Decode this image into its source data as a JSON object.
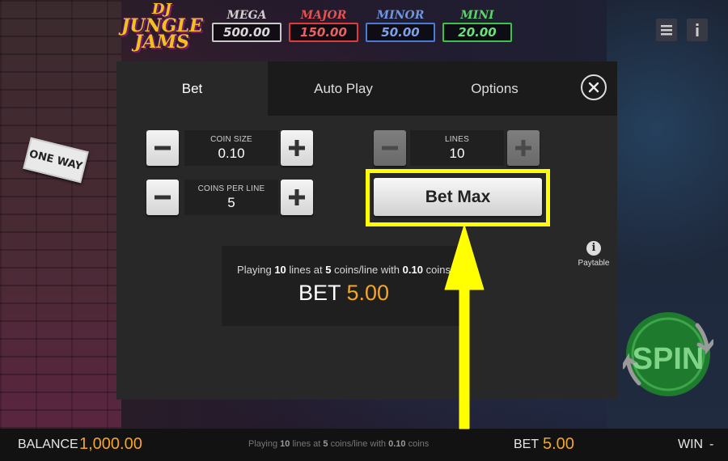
{
  "game": {
    "logo_lines": [
      "DJ",
      "JUNGLE",
      "JAMS"
    ],
    "street_sign": "ONE WAY"
  },
  "jackpots": [
    {
      "name": "MEGA",
      "value": "500.00",
      "color": "#c9c9c9"
    },
    {
      "name": "MAJOR",
      "value": "150.00",
      "color": "#e03a3a"
    },
    {
      "name": "MINOR",
      "value": "50.00",
      "color": "#4a7bd6"
    },
    {
      "name": "MINI",
      "value": "20.00",
      "color": "#3cc24a"
    }
  ],
  "top_icons": [
    "menu-icon",
    "info-icon"
  ],
  "dialog": {
    "tabs": [
      {
        "label": "Bet",
        "active": true
      },
      {
        "label": "Auto Play",
        "active": false
      },
      {
        "label": "Options",
        "active": false
      }
    ],
    "coin_size": {
      "label": "COIN SIZE",
      "value": "0.10"
    },
    "coins_per_line": {
      "label": "COINS PER LINE",
      "value": "5"
    },
    "lines": {
      "label": "LINES",
      "value": "10",
      "controls_disabled": true
    },
    "bet_max_label": "Bet Max",
    "summary": {
      "prefix": "Playing",
      "lines": "10",
      "mid1": "lines at",
      "coins": "5",
      "mid2": "coins/line with",
      "coin_size": "0.10",
      "suffix": "coins",
      "bet_label": "BET",
      "bet_value": "5.00"
    },
    "paytable_label": "Paytable"
  },
  "spin_label": "SPIN",
  "footer": {
    "balance_label": "BALANCE",
    "balance_value": "1,000.00",
    "summary": {
      "prefix": "Playing",
      "lines": "10",
      "mid1": "lines at",
      "coins": "5",
      "mid2": "coins/line with",
      "coin_size": "0.10",
      "suffix": "coins"
    },
    "bet_label": "BET",
    "bet_value": "5.00",
    "win_label": "WIN",
    "win_value": "-"
  },
  "colors": {
    "highlight": "#ffff00",
    "accent_amount": "#f5a623",
    "spin_green": "#1f8a2a"
  }
}
